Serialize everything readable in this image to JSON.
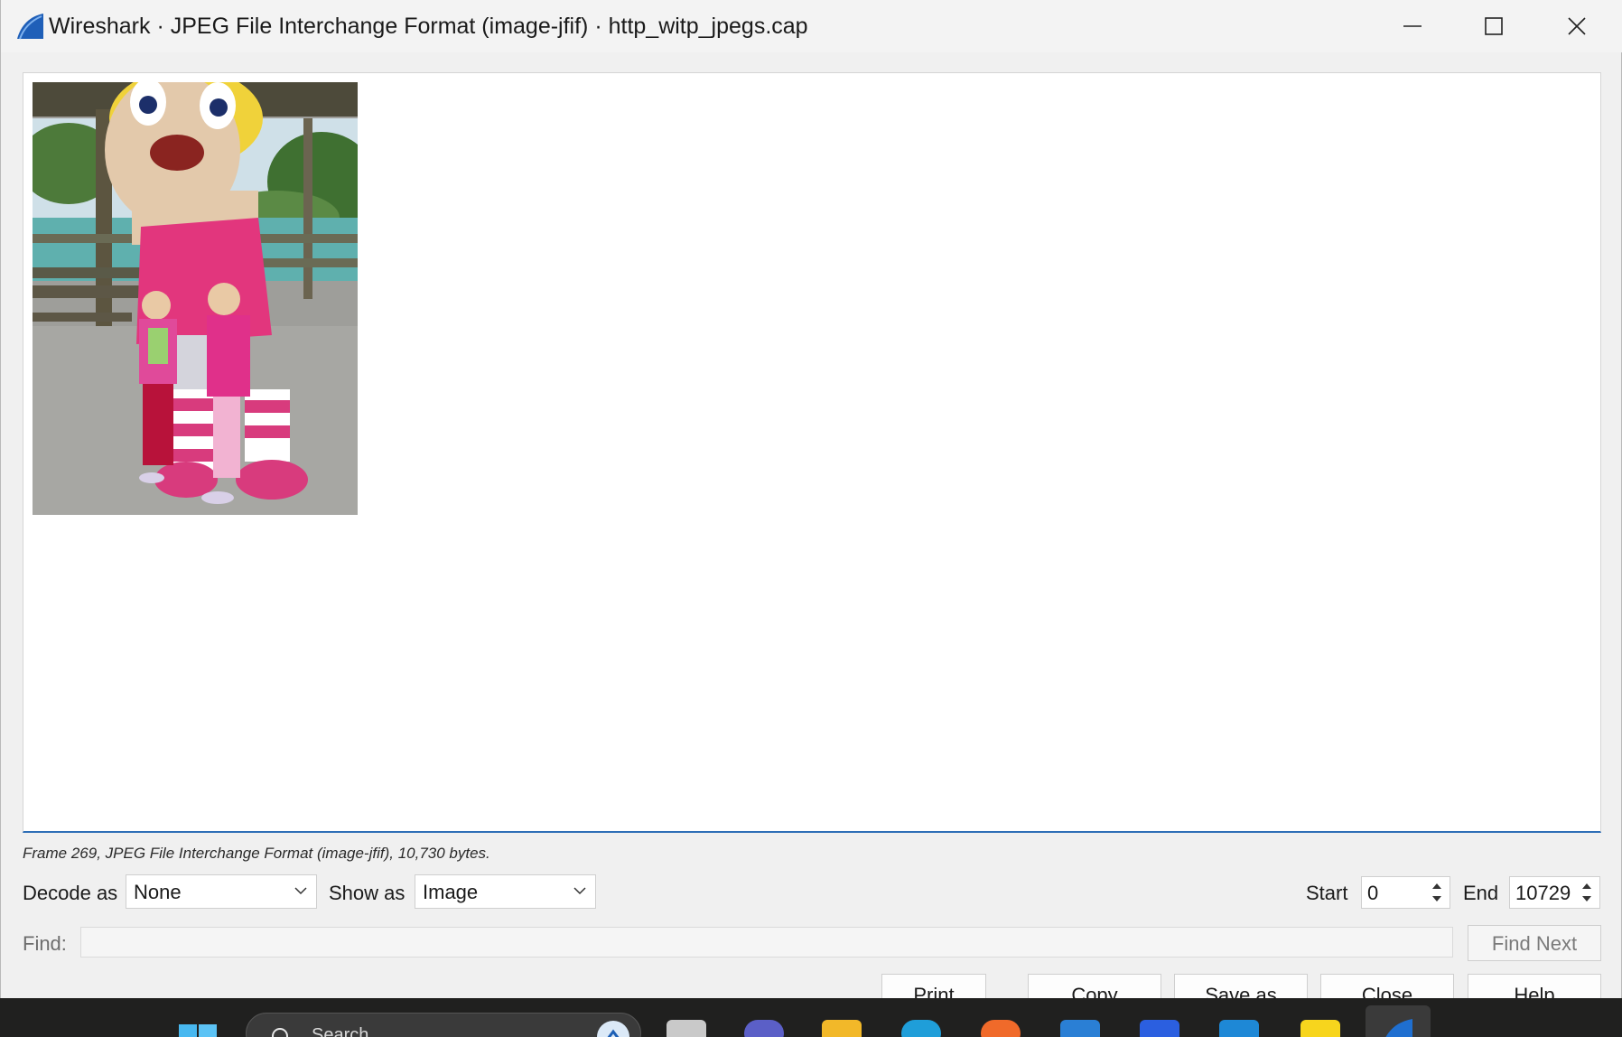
{
  "window": {
    "title": "Wireshark · JPEG File Interchange Format (image-jfif) · http_witp_jpegs.cap",
    "controls": [
      "minimize-icon",
      "maximize-icon",
      "close-icon"
    ]
  },
  "content": {
    "image_alt": "decoded JPEG image",
    "status": "Frame 269, JPEG File Interchange Format (image-jfif), 10,730 bytes."
  },
  "controls": {
    "decode_label": "Decode as",
    "decode_value": "None",
    "show_label": "Show as",
    "show_value": "Image",
    "start_label": "Start",
    "start_value": "0",
    "end_label": "End",
    "end_value": "10729"
  },
  "find": {
    "label": "Find:",
    "value": "",
    "next_label": "Find Next"
  },
  "buttons": {
    "print": "Print",
    "copy": "Copy",
    "save_as": "Save as",
    "close": "Close",
    "help": "Help"
  },
  "taskbar": {
    "search_placeholder": "Search",
    "apps": [
      "windows-start-icon",
      "search-icon",
      "task-view-icon",
      "teams-icon",
      "file-explorer-icon",
      "edge-icon",
      "firefox-icon",
      "store-icon",
      "app-icon",
      "vscode-icon",
      "sticky-notes-icon",
      "wireshark-icon"
    ]
  },
  "colors": {
    "accent": "#2f6fb7",
    "taskbar": "#20201f",
    "window_bg": "#f0f0f0"
  }
}
